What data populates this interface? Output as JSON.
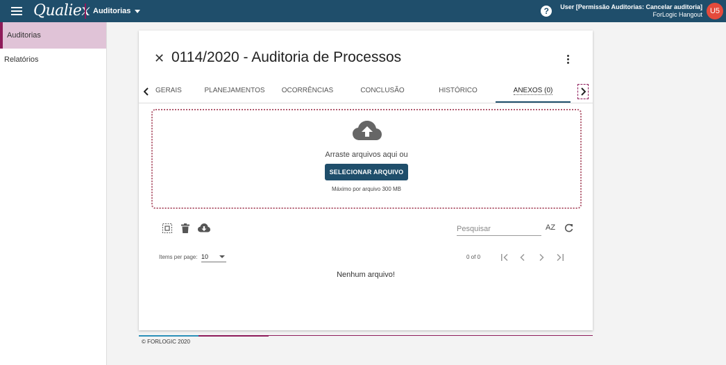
{
  "header": {
    "logo_text": "Qualiex",
    "module_label": "Auditorias",
    "user_name": "User [Permissão Auditorias: Cancelar auditoria]",
    "user_org": "ForLogic Hangout",
    "avatar_initials": "U5",
    "help_glyph": "?"
  },
  "sidebar": {
    "items": [
      {
        "label": "Auditorias",
        "active": true
      },
      {
        "label": "Relatórios",
        "active": false
      }
    ]
  },
  "main": {
    "title": "0114/2020 - Auditoria de Processos",
    "tabs": [
      {
        "label": "GERAIS",
        "active": false
      },
      {
        "label": "PLANEJAMENTOS",
        "active": false
      },
      {
        "label": "OCORRÊNCIAS",
        "active": false
      },
      {
        "label": "CONCLUSÃO",
        "active": false
      },
      {
        "label": "HISTÓRICO",
        "active": false
      },
      {
        "label": "ANEXOS (0)",
        "active": true
      }
    ],
    "dropzone": {
      "drop_text": "Arraste arquivos aqui ou",
      "select_button": "SELECIONAR ARQUIVO",
      "max_text": "Máximo por arquivo 300 MB"
    },
    "toolbar": {
      "search_placeholder": "Pesquisar",
      "sort_label": "AZ"
    },
    "pagination": {
      "items_per_page_label": "Items per page:",
      "items_per_page_value": "10",
      "range_label": "0 of 0"
    },
    "empty_message": "Nenhum arquivo!"
  },
  "footer": {
    "copyright": "© FORLOGIC 2020"
  },
  "colors": {
    "primary": "#1f4e6b",
    "accent": "#8e1b5a",
    "sidebar_active_bg": "#e0c3d7",
    "avatar": "#e54b3c"
  }
}
